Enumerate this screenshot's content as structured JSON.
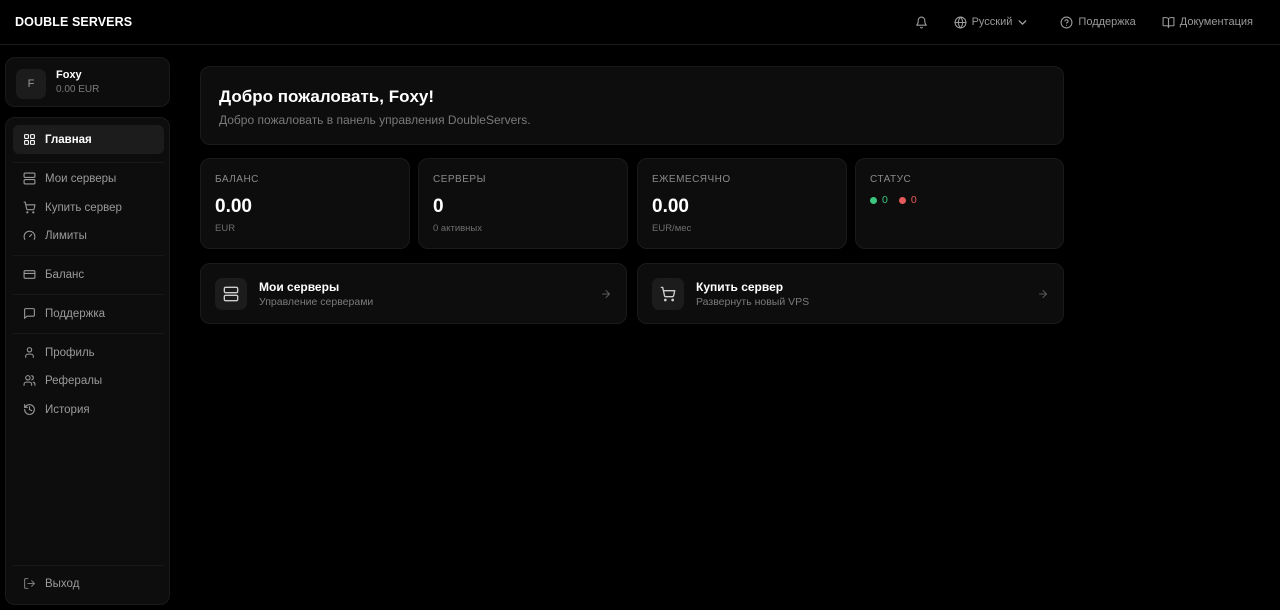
{
  "header": {
    "brand": "DOUBLE SERVERS",
    "language": "Русский",
    "support": "Поддержка",
    "docs": "Документация"
  },
  "user": {
    "initial": "F",
    "name": "Foxy",
    "balance": "0.00 EUR"
  },
  "nav": {
    "home": "Главная",
    "my_servers": "Мои серверы",
    "buy_server": "Купить сервер",
    "limits": "Лимиты",
    "balance": "Баланс",
    "support": "Поддержка",
    "profile": "Профиль",
    "referrals": "Рефералы",
    "history": "История",
    "logout": "Выход"
  },
  "welcome": {
    "title": "Добро пожаловать, Foxy!",
    "subtitle": "Добро пожаловать в панель управления DoubleServers."
  },
  "stats": {
    "balance": {
      "label": "БАЛАНС",
      "value": "0.00",
      "sub": "EUR"
    },
    "servers": {
      "label": "СЕРВЕРЫ",
      "value": "0",
      "sub": "0 активных"
    },
    "monthly": {
      "label": "ЕЖЕМЕСЯЧНО",
      "value": "0.00",
      "sub": "EUR/мес"
    },
    "status": {
      "label": "СТАТУС",
      "online": "0",
      "offline": "0"
    }
  },
  "actions": {
    "my_servers": {
      "title": "Мои серверы",
      "subtitle": "Управление серверами"
    },
    "buy_server": {
      "title": "Купить сервер",
      "subtitle": "Развернуть новый VPS"
    }
  },
  "colors": {
    "background": "#000000",
    "card": "#0d0d0d",
    "online": "#3cc67f",
    "offline": "#e55a5a"
  }
}
